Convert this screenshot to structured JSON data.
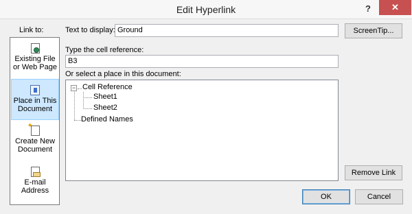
{
  "window": {
    "title": "Edit Hyperlink",
    "help_glyph": "?",
    "close_glyph": "✕"
  },
  "link_to": {
    "label": "Link to:",
    "items": [
      {
        "line1": "Existing File",
        "line2": "or Web Page",
        "icon": "existing-file-icon"
      },
      {
        "line1": "Place in This",
        "line2": "Document",
        "icon": "place-in-document-icon",
        "selected": true
      },
      {
        "line1": "Create New",
        "line2": "Document",
        "icon": "new-document-icon"
      },
      {
        "line1": "E-mail",
        "line2": "Address",
        "icon": "email-icon"
      }
    ]
  },
  "text_to_display": {
    "label": "Text to display:",
    "value": "Ground"
  },
  "screentip": {
    "label": "ScreenTip..."
  },
  "cell_reference": {
    "label": "Type the cell reference:",
    "value": "B3"
  },
  "place_select": {
    "label": "Or select a place in this document:",
    "tree": {
      "root1": {
        "label": "Cell Reference",
        "expander": "−",
        "children": [
          "Sheet1",
          "Sheet2"
        ]
      },
      "root2": {
        "label": "Defined Names"
      }
    }
  },
  "buttons": {
    "remove_link": "Remove Link",
    "ok": "OK",
    "cancel": "Cancel"
  },
  "colors": {
    "close_button": "#c75050",
    "selected_item_bg": "#cde8ff"
  }
}
